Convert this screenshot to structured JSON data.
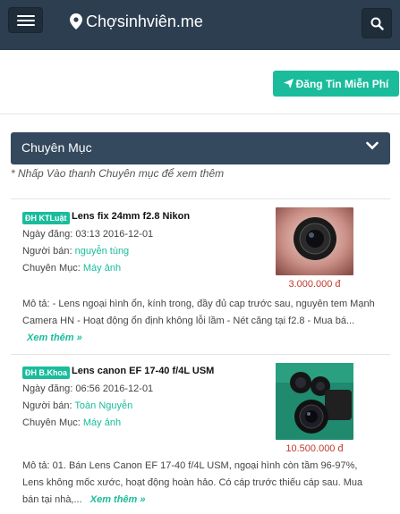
{
  "header": {
    "brand": "Chợsinhviên.me",
    "post_button": "Đăng Tin Miễn Phí"
  },
  "category": {
    "title": "Chuyên Mục",
    "hint": "* Nhấp Vào thanh Chuyên mục để xem thêm"
  },
  "listings": [
    {
      "badge": "ĐH KTLuật",
      "title": "Lens fix 24mm f2.8 Nikon",
      "date_label": "Ngày đăng:",
      "date": "03:13 2016-12-01",
      "seller_label": "Người bán:",
      "seller": "nguyễn tùng",
      "category_label": "Chuyên Mục:",
      "category": "Máy ảnh",
      "price": "3.000.000 đ",
      "desc_line1": "Mô tả: - Lens ngoại hình ổn, kính trong, đầy đủ cap trước sau, nguyên tem Mạnh",
      "desc_line2": "Camera HN - Hoạt động ổn định không lỗi lầm - Nét căng tại f2.8 - Mua bá...",
      "more": "Xem thêm »"
    },
    {
      "badge": "ĐH B.Khoa",
      "title": "Lens canon EF 17-40 f/4L USM",
      "date_label": "Ngày đăng:",
      "date": "06:56 2016-12-01",
      "seller_label": "Người bán:",
      "seller": "Toàn Nguyễn",
      "category_label": "Chuyên Mục:",
      "category": "Máy ảnh",
      "price": "10.500.000 đ",
      "desc_line1": "Mô tả: 01. Bán Lens Canon EF 17-40 f/4L USM, ngoại hình còn tầm 96-97%,",
      "desc_line2": "Lens không mốc xước, hoạt động hoàn hảo. Có cáp trước thiếu cáp sau. Mua",
      "desc_line3": "bán tại nhà,...",
      "more": "Xem thêm »"
    }
  ],
  "colors": {
    "navbar": "#2c3e50",
    "accent": "#1abc9c",
    "category_bar": "#34495e",
    "price": "#c0392b"
  },
  "icons": [
    "menu-icon",
    "map-pin-icon",
    "search-icon",
    "paper-plane-icon",
    "chevron-down-icon"
  ]
}
